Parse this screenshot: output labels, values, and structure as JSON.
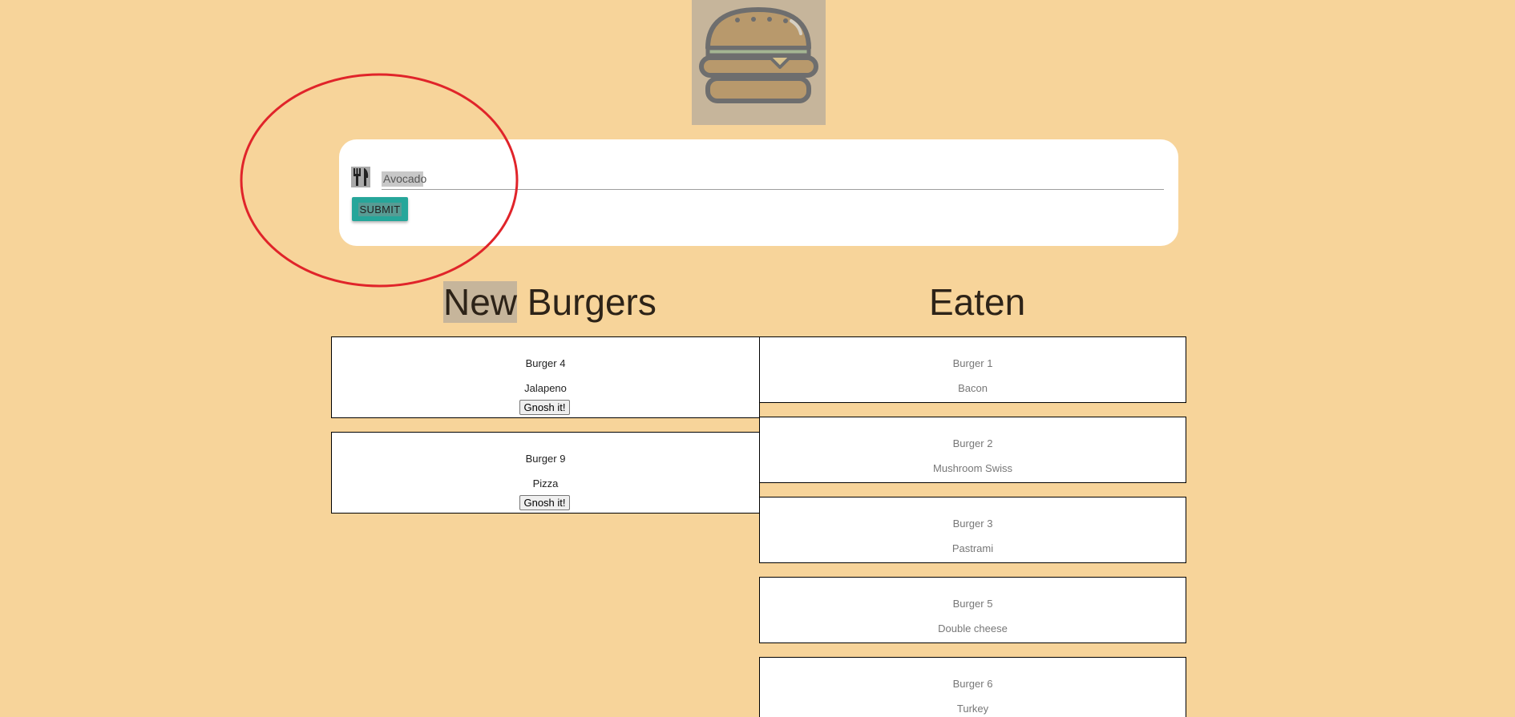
{
  "logo": {
    "icon": "burger-icon"
  },
  "form": {
    "icon": "utensils-icon",
    "input_value": "Avocado",
    "submit_label": "SUBMIT"
  },
  "colors": {
    "background": "#f7d49a",
    "accent": "#26a69a",
    "annotation": "#e0242a"
  },
  "new_burgers": {
    "title_first": "New",
    "title_rest": " Burgers",
    "items": [
      {
        "name": "Burger 4",
        "description": "Jalapeno",
        "button_label": "Gnosh it!"
      },
      {
        "name": "Burger 9",
        "description": "Pizza",
        "button_label": "Gnosh it!"
      }
    ]
  },
  "eaten": {
    "title": "Eaten",
    "items": [
      {
        "name": "Burger 1",
        "description": "Bacon"
      },
      {
        "name": "Burger 2",
        "description": "Mushroom Swiss"
      },
      {
        "name": "Burger 3",
        "description": "Pastrami"
      },
      {
        "name": "Burger 5",
        "description": "Double cheese"
      },
      {
        "name": "Burger 6",
        "description": "Turkey"
      }
    ]
  }
}
